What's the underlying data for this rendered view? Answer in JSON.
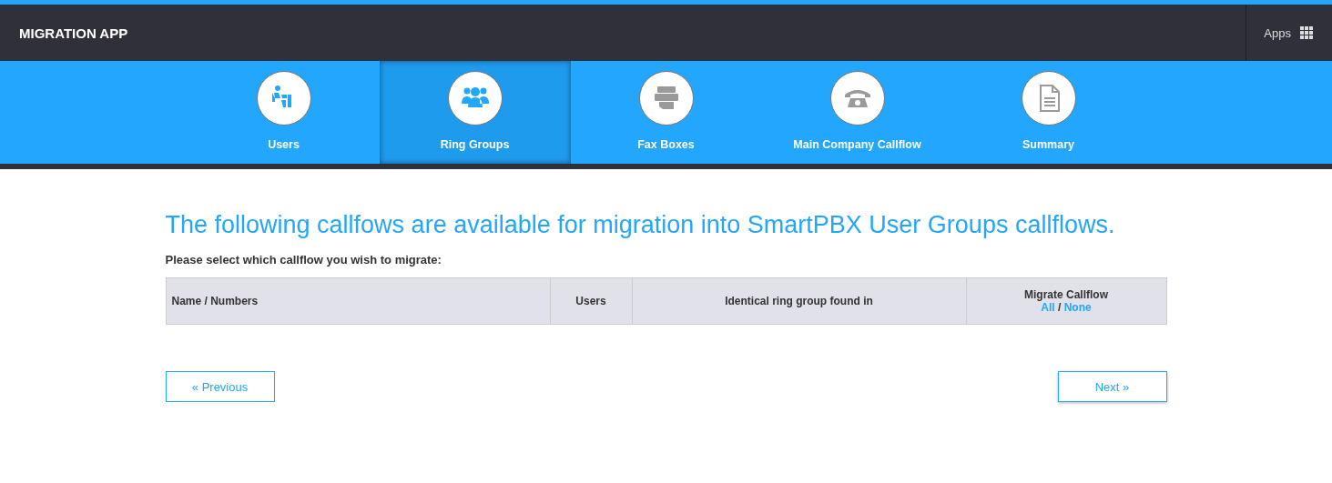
{
  "header": {
    "title": "MIGRATION APP",
    "apps_label": "Apps"
  },
  "steps": [
    {
      "label": "Users",
      "selected": false
    },
    {
      "label": "Ring Groups",
      "selected": true
    },
    {
      "label": "Fax Boxes",
      "selected": false
    },
    {
      "label": "Main Company Callflow",
      "selected": false
    },
    {
      "label": "Summary",
      "selected": false
    }
  ],
  "heading": "The following callfows are available for migration into SmartPBX User Groups callflows.",
  "instruction": "Please select which callflow you wish to migrate:",
  "table": {
    "columns": [
      "Name / Numbers",
      "Users",
      "Identical ring group found in",
      "Migrate Callflow"
    ],
    "select_all": "All",
    "separator": "/",
    "select_none": "None"
  },
  "buttons": {
    "previous": {
      "icon": "«",
      "label": "Previous"
    },
    "next": {
      "label": "Next",
      "icon": "»"
    }
  }
}
